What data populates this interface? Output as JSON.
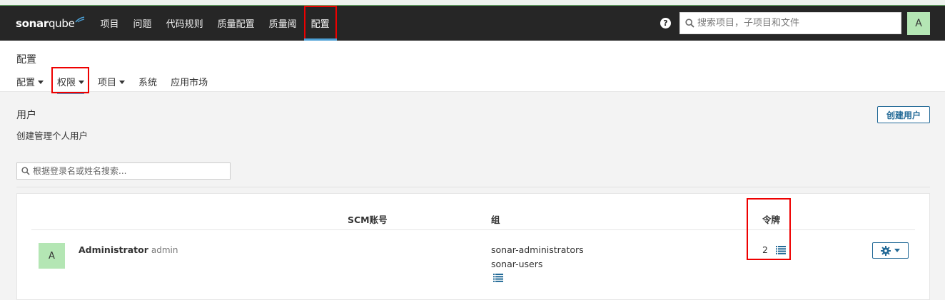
{
  "navbar": {
    "logo_sonar": "sonar",
    "logo_qube": "qube",
    "items": [
      {
        "label": "项目"
      },
      {
        "label": "问题"
      },
      {
        "label": "代码规则"
      },
      {
        "label": "质量配置"
      },
      {
        "label": "质量阈"
      },
      {
        "label": "配置"
      }
    ],
    "help_label": "?",
    "search_placeholder": "搜索项目，子项目和文件",
    "avatar_letter": "A"
  },
  "page": {
    "title": "配置",
    "tabs": [
      {
        "label": "配置",
        "dropdown": true
      },
      {
        "label": "权限",
        "dropdown": true
      },
      {
        "label": "项目",
        "dropdown": true
      },
      {
        "label": "系统",
        "dropdown": false
      },
      {
        "label": "应用市场",
        "dropdown": false
      }
    ]
  },
  "users": {
    "title": "用户",
    "description": "创建管理个人用户",
    "create_button": "创建用户",
    "filter_placeholder": "根据登录名或姓名搜索...",
    "columns": {
      "scm": "SCM账号",
      "groups": "组",
      "tokens": "令牌"
    },
    "rows": [
      {
        "avatar": "A",
        "name": "Administrator",
        "login": "admin",
        "groups": [
          "sonar-administrators",
          "sonar-users"
        ],
        "tokens": "2"
      }
    ]
  },
  "colors": {
    "navbar_bg": "#262626",
    "accent": "#4b9fd5",
    "button_blue": "#236a97",
    "avatar_green": "#b4e6b4",
    "highlight_red": "#e00000"
  }
}
